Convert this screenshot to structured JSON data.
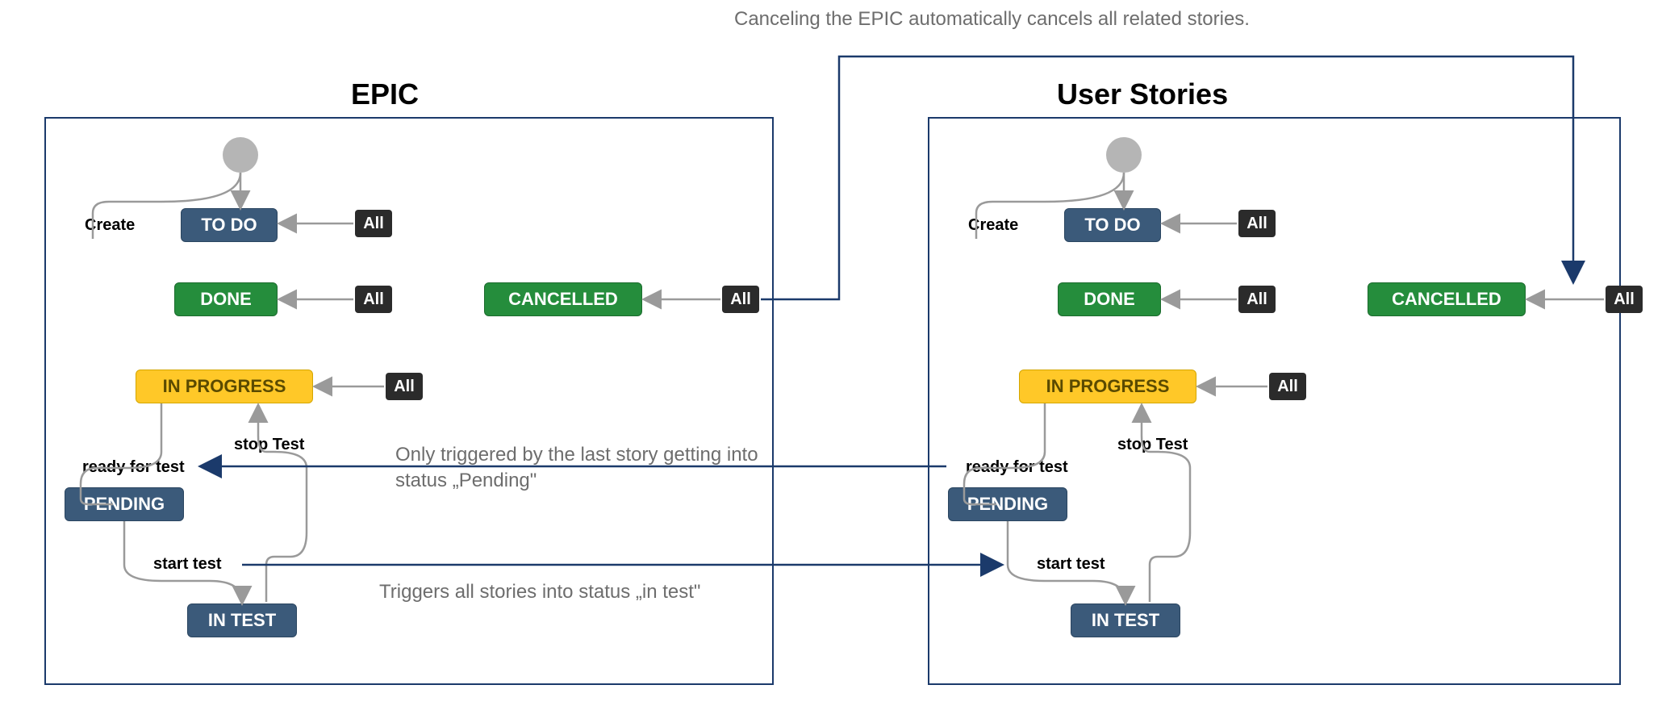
{
  "titles": {
    "epic": "EPIC",
    "stories": "User Stories"
  },
  "states": {
    "todo": "TO DO",
    "done": "DONE",
    "cancelled": "CANCELLED",
    "in_progress": "IN PROGRESS",
    "pending": "PENDING",
    "in_test": "IN TEST"
  },
  "labels": {
    "create": "Create",
    "all": "All",
    "ready_for_test": "ready for test",
    "stop_test": "stop Test",
    "start_test": "start test"
  },
  "annotations": {
    "cancel": "Canceling the EPIC automatically cancels all related stories.",
    "pending": "Only triggered by the last story getting into status „Pending\"",
    "in_test": "Triggers all stories into status „in test\""
  },
  "colors": {
    "blue": "#3b5a7a",
    "green": "#258d3c",
    "yellow": "#ffc828",
    "dark": "#2b2b2b",
    "border": "#1b3a6b",
    "grey": "#6d6d6d"
  }
}
